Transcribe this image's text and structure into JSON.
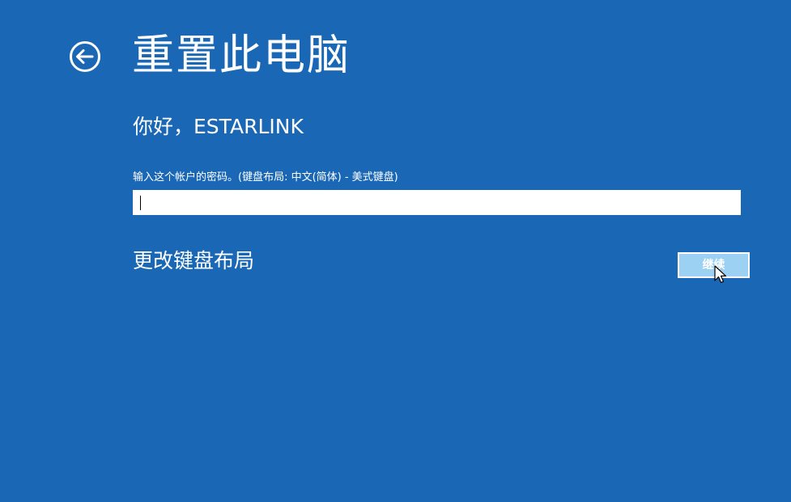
{
  "header": {
    "title": "重置此电脑",
    "back_icon": "back-arrow-circle-icon"
  },
  "account": {
    "greeting": "你好，ESTARLINK"
  },
  "password": {
    "label": "输入这个帐户的密码。(键盘布局: 中文(简体) - 美式键盘)",
    "value": ""
  },
  "actions": {
    "change_layout_label": "更改键盘布局",
    "continue_label": "继续"
  },
  "colors": {
    "background": "#1a68b5",
    "button_fill": "#9dd1f3",
    "text": "#ffffff"
  }
}
